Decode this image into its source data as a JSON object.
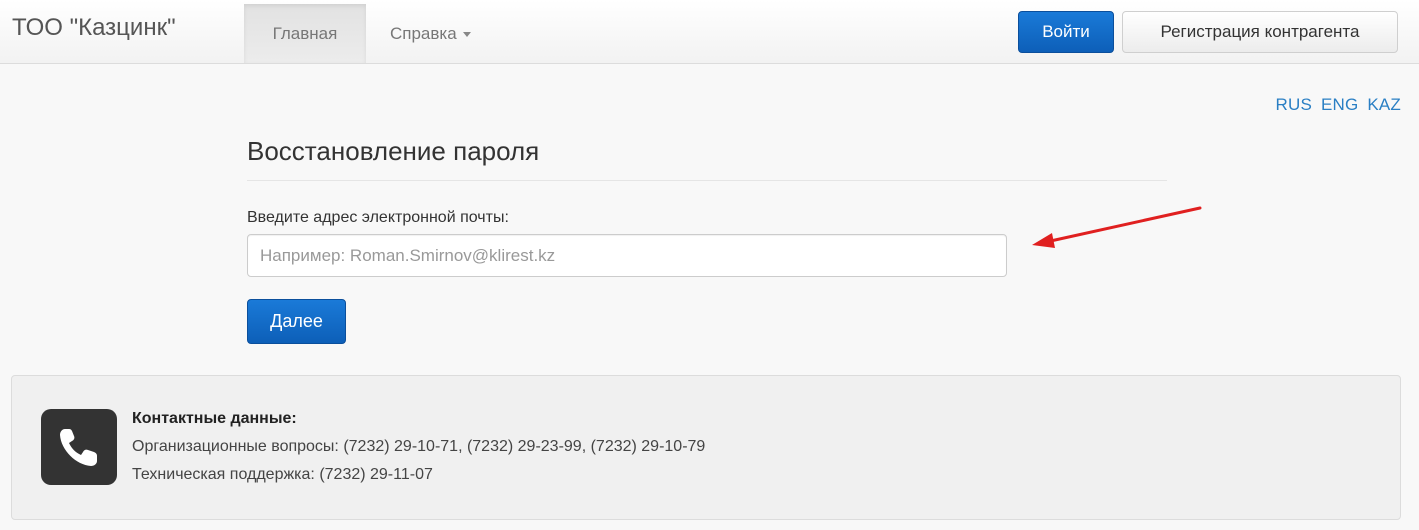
{
  "navbar": {
    "brand": "ТОО \"Казцинк\"",
    "tabs": [
      {
        "label": "Главная",
        "active": true
      },
      {
        "label": "Справка",
        "dropdown": true
      }
    ],
    "login_label": "Войти",
    "register_label": "Регистрация контрагента"
  },
  "languages": [
    "RUS",
    "ENG",
    "KAZ"
  ],
  "form": {
    "title": "Восстановление пароля",
    "email_label": "Введите адрес электронной почты:",
    "email_value": "",
    "email_placeholder": "Например: Roman.Smirnov@klirest.kz",
    "next_label": "Далее"
  },
  "contacts": {
    "title": "Контактные данные:",
    "org_questions": "Организационные вопросы: (7232) 29-10-71, (7232) 29-23-99, (7232) 29-10-79",
    "tech_support": "Техническая поддержка: (7232) 29-11-07"
  },
  "colors": {
    "primary": "#0d5fb8",
    "link": "#2a7fc4",
    "annotation_arrow": "#e02020"
  },
  "icons": {
    "phone": "phone-icon",
    "caret": "chevron-down-icon",
    "arrow": "annotation-arrow-icon"
  }
}
